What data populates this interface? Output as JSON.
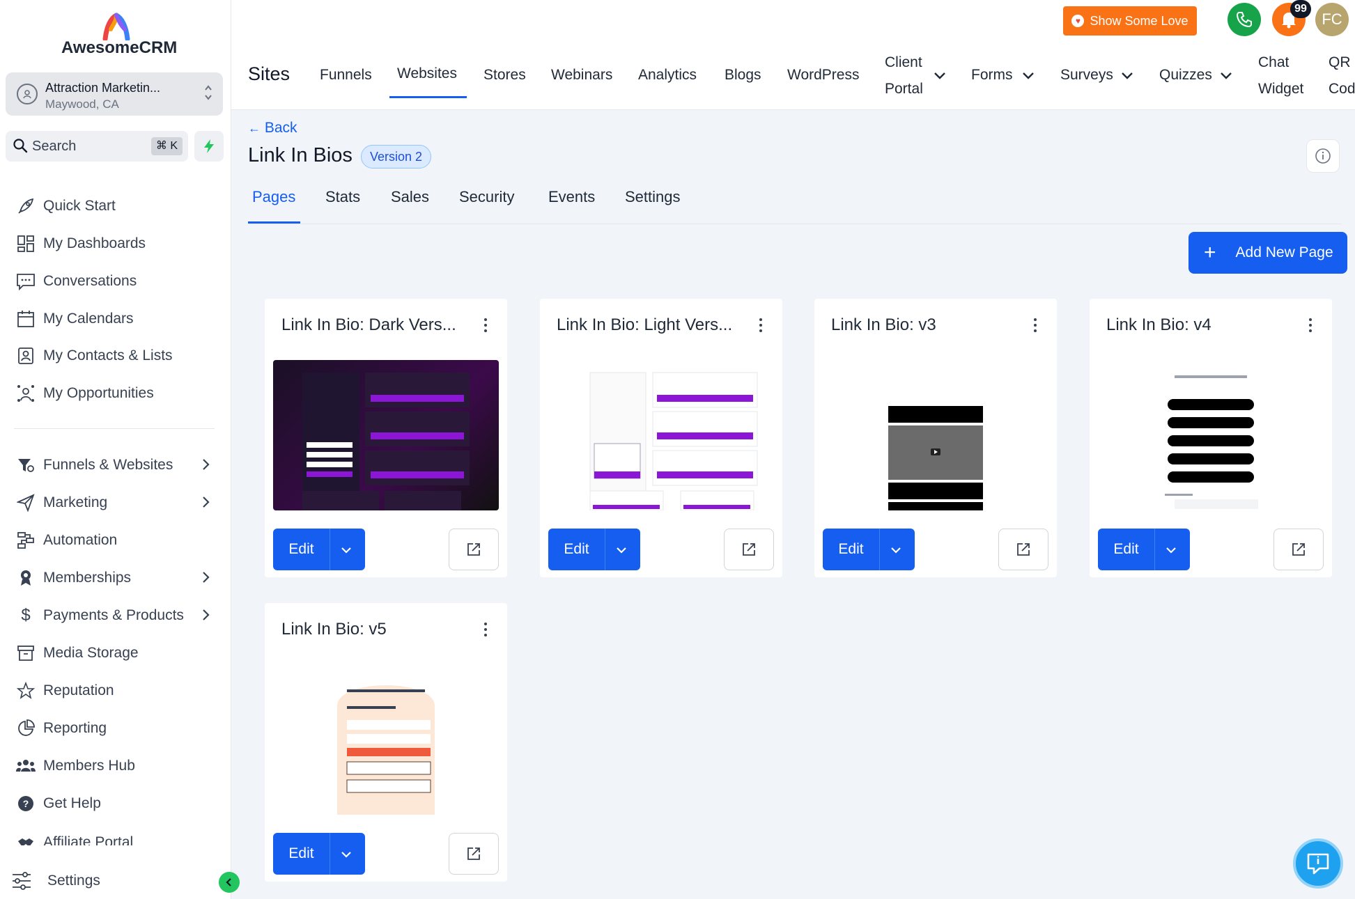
{
  "sidebar": {
    "brand": "AwesomeCRM",
    "account": {
      "name": "Attraction Marketin...",
      "location": "Maywood, CA"
    },
    "search": {
      "placeholder": "Search",
      "shortcut": "⌘ K"
    },
    "items": [
      {
        "label": "Quick Start",
        "icon": "rocket-icon"
      },
      {
        "label": "My Dashboards",
        "icon": "dashboard-icon"
      },
      {
        "label": "Conversations",
        "icon": "chat-icon"
      },
      {
        "label": "My Calendars",
        "icon": "calendar-icon"
      },
      {
        "label": "My Contacts & Lists",
        "icon": "contacts-icon"
      },
      {
        "label": "My Opportunities",
        "icon": "opportunities-icon"
      },
      {
        "label": "Funnels & Websites",
        "icon": "funnel-icon"
      },
      {
        "label": "Marketing",
        "icon": "send-icon"
      },
      {
        "label": "Automation",
        "icon": "automation-icon"
      },
      {
        "label": "Memberships",
        "icon": "award-icon"
      },
      {
        "label": "Payments & Products",
        "icon": "dollar-icon"
      },
      {
        "label": "Media Storage",
        "icon": "archive-icon"
      },
      {
        "label": "Reputation",
        "icon": "star-icon"
      },
      {
        "label": "Reporting",
        "icon": "chart-icon"
      },
      {
        "label": "Members Hub",
        "icon": "users-icon"
      },
      {
        "label": "Get Help",
        "icon": "help-icon"
      },
      {
        "label": "Affiliate Portal",
        "icon": "handshake-icon"
      }
    ],
    "settings_label": "Settings"
  },
  "header": {
    "love_button": "Show Some Love",
    "notification_count": "99",
    "avatar_initials": "FC",
    "section_title": "Sites",
    "nav": [
      {
        "label": "Funnels"
      },
      {
        "label": "Websites",
        "active": true
      },
      {
        "label": "Stores"
      },
      {
        "label": "Webinars"
      },
      {
        "label": "Analytics"
      },
      {
        "label": "Blogs"
      },
      {
        "label": "WordPress"
      },
      {
        "label_line1": "Client",
        "label_line2": "Portal",
        "dropdown": true
      },
      {
        "label": "Forms",
        "dropdown": true
      },
      {
        "label": "Surveys",
        "dropdown": true
      },
      {
        "label": "Quizzes",
        "dropdown": true
      },
      {
        "label_line1": "Chat",
        "label_line2": "Widget"
      },
      {
        "label_line1": "QR",
        "label_line2": "Cod"
      }
    ]
  },
  "content": {
    "back_label": "Back",
    "title": "Link In Bios",
    "version_badge": "Version 2",
    "tabs": [
      "Pages",
      "Stats",
      "Sales",
      "Security",
      "Events",
      "Settings"
    ],
    "active_tab": "Pages",
    "add_button": "Add New Page",
    "pages": [
      {
        "title": "Link In Bio: Dark Vers...",
        "edit_label": "Edit"
      },
      {
        "title": "Link In Bio: Light Vers...",
        "edit_label": "Edit"
      },
      {
        "title": "Link In Bio: v3",
        "edit_label": "Edit"
      },
      {
        "title": "Link In Bio: v4",
        "edit_label": "Edit"
      },
      {
        "title": "Link In Bio: v5",
        "edit_label": "Edit"
      }
    ]
  },
  "colors": {
    "primary": "#155eef",
    "love": "#f97316",
    "phone": "#16a34a",
    "bell": "#f97316",
    "help": "#1ea1ee"
  }
}
